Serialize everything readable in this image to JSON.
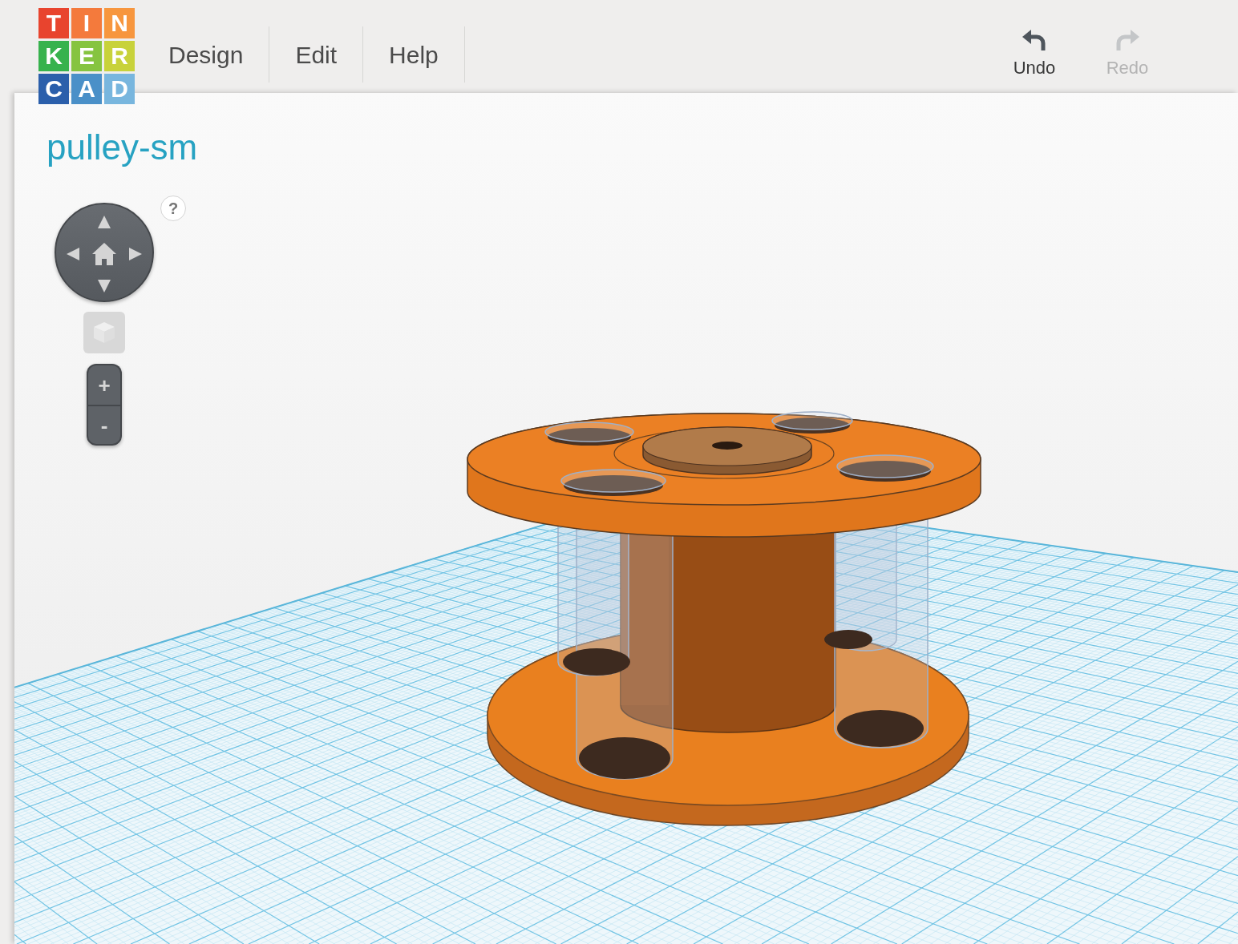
{
  "app_bar": {
    "logo": [
      {
        "text": "T",
        "color": "#e8442e"
      },
      {
        "text": "I",
        "color": "#f47a3c"
      },
      {
        "text": "N",
        "color": "#f7963e"
      },
      {
        "text": "K",
        "color": "#37b24d"
      },
      {
        "text": "E",
        "color": "#86c440"
      },
      {
        "text": "R",
        "color": "#c8d23b"
      },
      {
        "text": "C",
        "color": "#2b5fab"
      },
      {
        "text": "A",
        "color": "#4a90c8"
      },
      {
        "text": "D",
        "color": "#78b6de"
      }
    ],
    "menu": [
      {
        "label": "Design"
      },
      {
        "label": "Edit"
      },
      {
        "label": "Help"
      }
    ],
    "history": [
      {
        "kind": "undo",
        "label": "Undo",
        "disabled": false
      },
      {
        "kind": "redo",
        "label": "Redo",
        "disabled": true
      }
    ]
  },
  "design": {
    "title": "pulley-sm"
  },
  "view_controls": {
    "help": "?",
    "zoom": [
      {
        "label": "+"
      },
      {
        "label": "-"
      }
    ]
  }
}
